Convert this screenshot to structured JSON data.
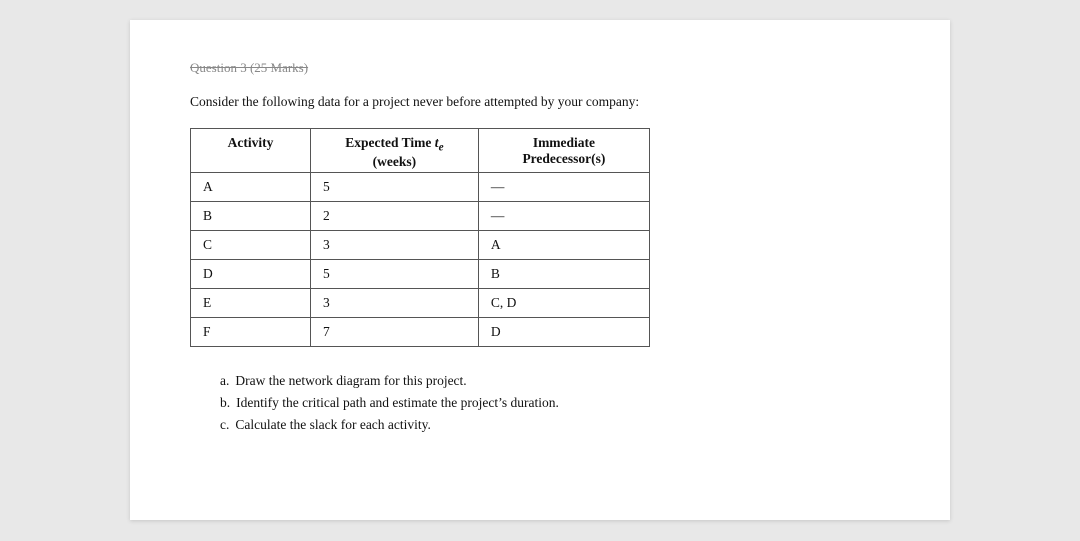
{
  "header": {
    "question_partial": "Question 3 (25 Marks)"
  },
  "intro_text": "Consider the following data for a project never before attempted by your company:",
  "table": {
    "columns": [
      "Activity",
      "Expected Time te (weeks)",
      "Immediate Predecessor(s)"
    ],
    "rows": [
      {
        "activity": "A",
        "time": "5",
        "predecessor": "—"
      },
      {
        "activity": "B",
        "time": "2",
        "predecessor": "—"
      },
      {
        "activity": "C",
        "time": "3",
        "predecessor": "A"
      },
      {
        "activity": "D",
        "time": "5",
        "predecessor": "B"
      },
      {
        "activity": "E",
        "time": "3",
        "predecessor": "C, D"
      },
      {
        "activity": "F",
        "time": "7",
        "predecessor": "D"
      }
    ]
  },
  "parts": [
    {
      "letter": "a.",
      "text": "Draw the network diagram for this project."
    },
    {
      "letter": "b.",
      "text": "Identify the critical path and estimate the project’s duration."
    },
    {
      "letter": "c.",
      "text": "Calculate the slack for each activity."
    }
  ]
}
